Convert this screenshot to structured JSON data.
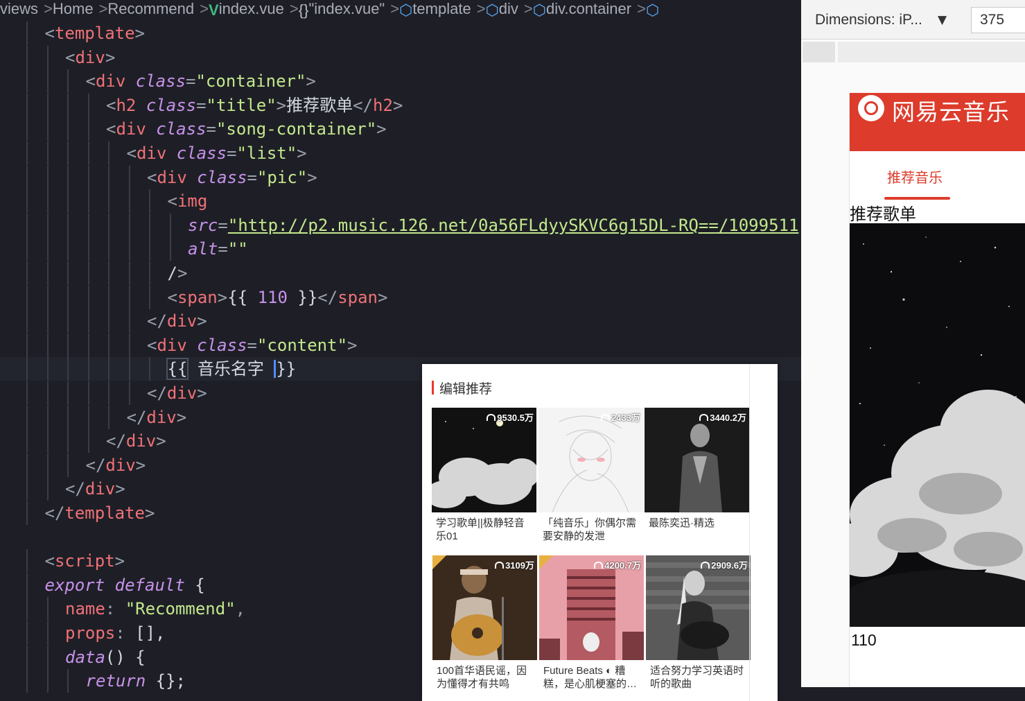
{
  "breadcrumb": {
    "items": [
      "views",
      "Home",
      "Recommend",
      "index.vue",
      "\"index.vue\"",
      "template",
      "div",
      "div.container"
    ]
  },
  "code": {
    "lines": [
      "<template>",
      "<div>",
      "<div class=\"container\">",
      "<h2 class=\"title\">推荐歌单</h2>",
      "<div class=\"song-container\">",
      "<div class=\"list\">",
      "<div class=\"pic\">",
      "<img",
      "src=\"http://p2.music.126.net/0a56FLdyySKVC6g15DL-RQ==/1099511\"",
      "alt=\"\"",
      "/>",
      "<span>{{ 110 }}</span>",
      "</div>",
      "<div class=\"content\">",
      "{{ 音乐名字 }}",
      "</div>",
      "</div>",
      "</div>",
      "</div>",
      "</div>",
      "</template>",
      "",
      "<script>",
      "export default {",
      "name: \"Recommend\",",
      "props: [],",
      "data() {",
      "return {};"
    ]
  },
  "netease_panel": {
    "heading": "编辑推荐",
    "playlists": [
      {
        "count": "9530.5万",
        "title": "学习歌单||极静轻音乐01"
      },
      {
        "count": "2433万",
        "title": "「纯音乐」你偶尔需要安静的发泄"
      },
      {
        "count": "3440.2万",
        "title": "最陈奕迅·精选"
      },
      {
        "count": "3109万",
        "title": "100首华语民谣，因为懂得才有共鸣"
      },
      {
        "count": "4200.7万",
        "title": "Future Beats ◐ 糟糕，是心肌梗塞的…"
      },
      {
        "count": "2909.6万",
        "title": "适合努力学习英语时听的歌曲"
      }
    ]
  },
  "devtools": {
    "dimensions_label": "Dimensions: iP...",
    "width_value": "375"
  },
  "preview": {
    "brand": "网易云音乐",
    "tab": "推荐音乐",
    "title": "推荐歌单",
    "count": "110"
  }
}
